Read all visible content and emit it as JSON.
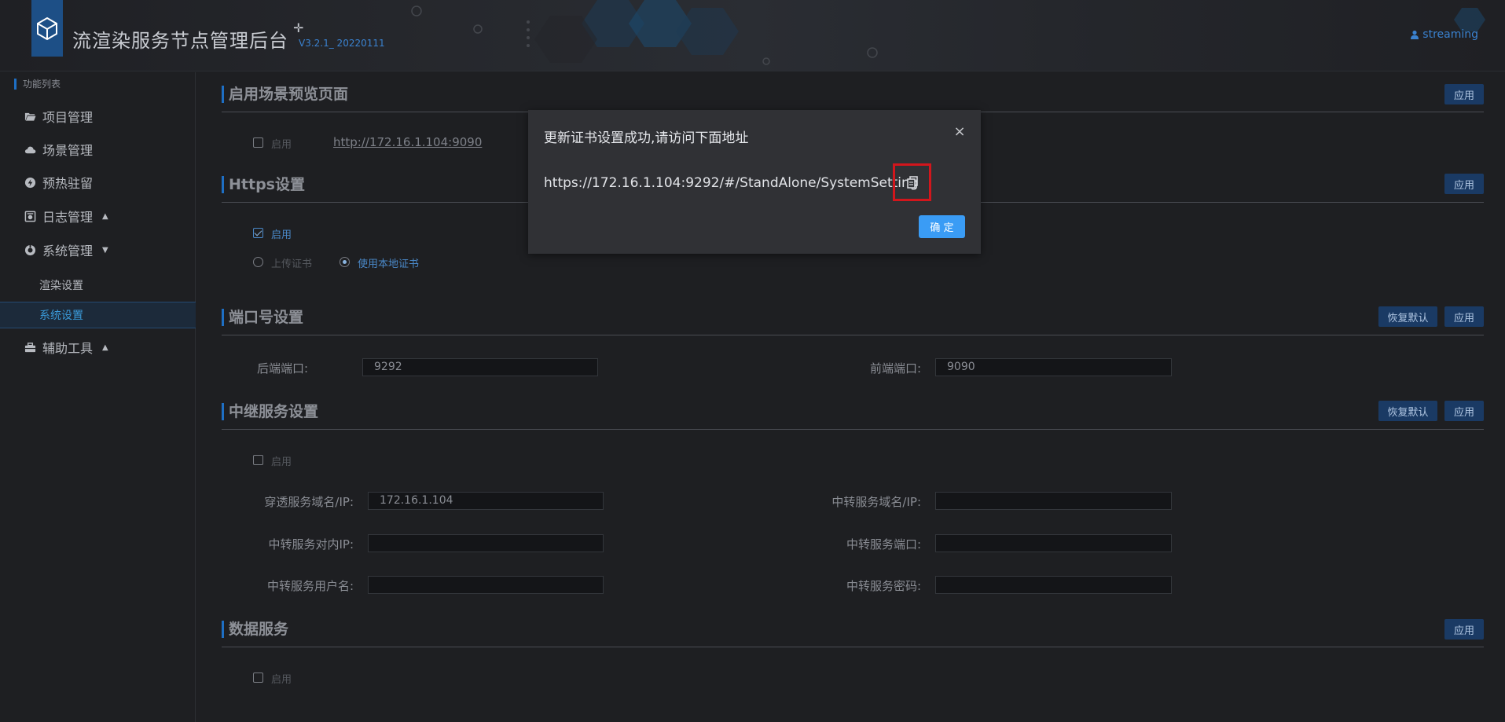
{
  "header": {
    "app_title": "流渲染服务节点管理后台",
    "title_symbol": "✛",
    "version": "V3.2.1_ 20220111",
    "user": "streaming"
  },
  "sidebar": {
    "title": "功能列表",
    "items": [
      {
        "label": "项目管理",
        "icon": "folder-open-icon"
      },
      {
        "label": "场景管理",
        "icon": "cloud-icon"
      },
      {
        "label": "预热驻留",
        "icon": "bolt-icon"
      },
      {
        "label": "日志管理",
        "icon": "log-icon",
        "caret": "▲"
      },
      {
        "label": "系统管理",
        "icon": "system-icon",
        "caret": "▼"
      },
      {
        "label": "辅助工具",
        "icon": "toolbox-icon",
        "caret": "▲"
      }
    ],
    "sub_items": [
      {
        "label": "渲染设置",
        "active": false
      },
      {
        "label": "系统设置",
        "active": true
      }
    ]
  },
  "sections": {
    "preview": {
      "title": "启用场景预览页面",
      "apply": "应用",
      "enable_label": "启用",
      "enabled": false,
      "link": "http://172.16.1.104:9090"
    },
    "https": {
      "title": "Https设置",
      "apply": "应用",
      "enable_label": "启用",
      "enabled": true,
      "radio_upload": "上传证书",
      "radio_local": "使用本地证书",
      "selected": "local"
    },
    "port": {
      "title": "端口号设置",
      "reset": "恢复默认",
      "apply": "应用",
      "backend_label": "后端端口:",
      "backend_value": "9292",
      "frontend_label": "前端端口:",
      "frontend_value": "9090"
    },
    "relay": {
      "title": "中继服务设置",
      "reset": "恢复默认",
      "apply": "应用",
      "enable_label": "启用",
      "enabled": false,
      "penetrate_label": "穿透服务域名/IP:",
      "penetrate_value": "172.16.1.104",
      "relay_domain_label": "中转服务域名/IP:",
      "relay_domain_value": "",
      "relay_inner_ip_label": "中转服务对内IP:",
      "relay_inner_ip_value": "",
      "relay_port_label": "中转服务端口:",
      "relay_port_value": "",
      "relay_user_label": "中转服务用户名:",
      "relay_user_value": "",
      "relay_pwd_label": "中转服务密码:",
      "relay_pwd_value": ""
    },
    "data": {
      "title": "数据服务",
      "apply": "应用",
      "enable_label": "启用",
      "enabled": false
    }
  },
  "dialog": {
    "title": "更新证书设置成功,请访问下面地址",
    "close": "×",
    "url": "https://172.16.1.104:9292/#/StandAlone/SystemSetting",
    "ok": "确 定"
  },
  "colors": {
    "accent": "#1e6fc4",
    "link_blue": "#3a82d0",
    "ok_button": "#3a9cf5",
    "highlight_red": "#d2161c"
  }
}
